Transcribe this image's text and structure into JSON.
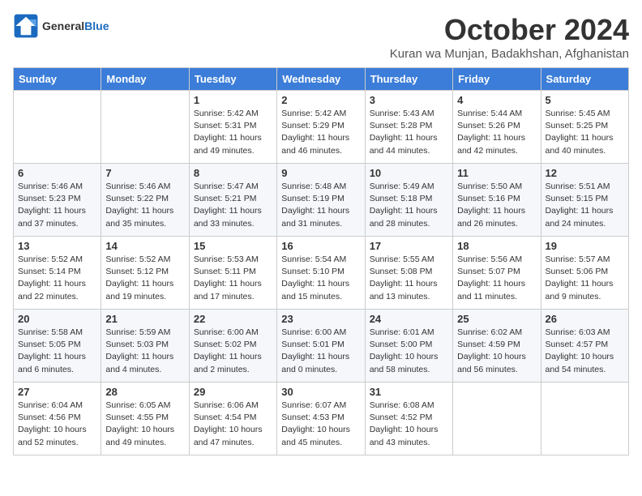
{
  "header": {
    "logo_line1": "General",
    "logo_line2": "Blue",
    "month": "October 2024",
    "location": "Kuran wa Munjan, Badakhshan, Afghanistan"
  },
  "weekdays": [
    "Sunday",
    "Monday",
    "Tuesday",
    "Wednesday",
    "Thursday",
    "Friday",
    "Saturday"
  ],
  "weeks": [
    [
      {
        "day": null,
        "sunrise": null,
        "sunset": null,
        "daylight": null
      },
      {
        "day": null,
        "sunrise": null,
        "sunset": null,
        "daylight": null
      },
      {
        "day": "1",
        "sunrise": "5:42 AM",
        "sunset": "5:31 PM",
        "daylight": "11 hours and 49 minutes."
      },
      {
        "day": "2",
        "sunrise": "5:42 AM",
        "sunset": "5:29 PM",
        "daylight": "11 hours and 46 minutes."
      },
      {
        "day": "3",
        "sunrise": "5:43 AM",
        "sunset": "5:28 PM",
        "daylight": "11 hours and 44 minutes."
      },
      {
        "day": "4",
        "sunrise": "5:44 AM",
        "sunset": "5:26 PM",
        "daylight": "11 hours and 42 minutes."
      },
      {
        "day": "5",
        "sunrise": "5:45 AM",
        "sunset": "5:25 PM",
        "daylight": "11 hours and 40 minutes."
      }
    ],
    [
      {
        "day": "6",
        "sunrise": "5:46 AM",
        "sunset": "5:23 PM",
        "daylight": "11 hours and 37 minutes."
      },
      {
        "day": "7",
        "sunrise": "5:46 AM",
        "sunset": "5:22 PM",
        "daylight": "11 hours and 35 minutes."
      },
      {
        "day": "8",
        "sunrise": "5:47 AM",
        "sunset": "5:21 PM",
        "daylight": "11 hours and 33 minutes."
      },
      {
        "day": "9",
        "sunrise": "5:48 AM",
        "sunset": "5:19 PM",
        "daylight": "11 hours and 31 minutes."
      },
      {
        "day": "10",
        "sunrise": "5:49 AM",
        "sunset": "5:18 PM",
        "daylight": "11 hours and 28 minutes."
      },
      {
        "day": "11",
        "sunrise": "5:50 AM",
        "sunset": "5:16 PM",
        "daylight": "11 hours and 26 minutes."
      },
      {
        "day": "12",
        "sunrise": "5:51 AM",
        "sunset": "5:15 PM",
        "daylight": "11 hours and 24 minutes."
      }
    ],
    [
      {
        "day": "13",
        "sunrise": "5:52 AM",
        "sunset": "5:14 PM",
        "daylight": "11 hours and 22 minutes."
      },
      {
        "day": "14",
        "sunrise": "5:52 AM",
        "sunset": "5:12 PM",
        "daylight": "11 hours and 19 minutes."
      },
      {
        "day": "15",
        "sunrise": "5:53 AM",
        "sunset": "5:11 PM",
        "daylight": "11 hours and 17 minutes."
      },
      {
        "day": "16",
        "sunrise": "5:54 AM",
        "sunset": "5:10 PM",
        "daylight": "11 hours and 15 minutes."
      },
      {
        "day": "17",
        "sunrise": "5:55 AM",
        "sunset": "5:08 PM",
        "daylight": "11 hours and 13 minutes."
      },
      {
        "day": "18",
        "sunrise": "5:56 AM",
        "sunset": "5:07 PM",
        "daylight": "11 hours and 11 minutes."
      },
      {
        "day": "19",
        "sunrise": "5:57 AM",
        "sunset": "5:06 PM",
        "daylight": "11 hours and 9 minutes."
      }
    ],
    [
      {
        "day": "20",
        "sunrise": "5:58 AM",
        "sunset": "5:05 PM",
        "daylight": "11 hours and 6 minutes."
      },
      {
        "day": "21",
        "sunrise": "5:59 AM",
        "sunset": "5:03 PM",
        "daylight": "11 hours and 4 minutes."
      },
      {
        "day": "22",
        "sunrise": "6:00 AM",
        "sunset": "5:02 PM",
        "daylight": "11 hours and 2 minutes."
      },
      {
        "day": "23",
        "sunrise": "6:00 AM",
        "sunset": "5:01 PM",
        "daylight": "11 hours and 0 minutes."
      },
      {
        "day": "24",
        "sunrise": "6:01 AM",
        "sunset": "5:00 PM",
        "daylight": "10 hours and 58 minutes."
      },
      {
        "day": "25",
        "sunrise": "6:02 AM",
        "sunset": "4:59 PM",
        "daylight": "10 hours and 56 minutes."
      },
      {
        "day": "26",
        "sunrise": "6:03 AM",
        "sunset": "4:57 PM",
        "daylight": "10 hours and 54 minutes."
      }
    ],
    [
      {
        "day": "27",
        "sunrise": "6:04 AM",
        "sunset": "4:56 PM",
        "daylight": "10 hours and 52 minutes."
      },
      {
        "day": "28",
        "sunrise": "6:05 AM",
        "sunset": "4:55 PM",
        "daylight": "10 hours and 49 minutes."
      },
      {
        "day": "29",
        "sunrise": "6:06 AM",
        "sunset": "4:54 PM",
        "daylight": "10 hours and 47 minutes."
      },
      {
        "day": "30",
        "sunrise": "6:07 AM",
        "sunset": "4:53 PM",
        "daylight": "10 hours and 45 minutes."
      },
      {
        "day": "31",
        "sunrise": "6:08 AM",
        "sunset": "4:52 PM",
        "daylight": "10 hours and 43 minutes."
      },
      {
        "day": null,
        "sunrise": null,
        "sunset": null,
        "daylight": null
      },
      {
        "day": null,
        "sunrise": null,
        "sunset": null,
        "daylight": null
      }
    ]
  ],
  "labels": {
    "sunrise_prefix": "Sunrise: ",
    "sunset_prefix": "Sunset: ",
    "daylight_prefix": "Daylight: "
  }
}
